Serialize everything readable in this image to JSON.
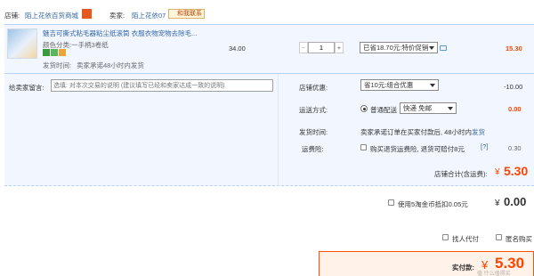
{
  "shop": {
    "label": "店铺:",
    "name": "陌上花依百货商城",
    "seller_label": "卖家:",
    "seller_name": "陌上花依07",
    "contact": "和我联系"
  },
  "item": {
    "title": "魅吉可撕式粘毛器粘尘纸滚筒 衣服衣物宠物去除毛...",
    "variant": "颜色分类:一手柄3卷纸",
    "shipping_time_label": "发货时间:",
    "shipping_time": "卖家承诺48小时内发货",
    "price": "34.00",
    "quantity": "1",
    "discount_option": "已省18.70元:特价促销",
    "subtotal": "15.30"
  },
  "message": {
    "label": "给卖家留言:",
    "placeholder": "选填: 对本次交易的说明 (建议填写已经和卖家达成一致的说明)"
  },
  "coupon": {
    "label": "店铺优惠:",
    "option": "省10元:组合优惠",
    "amount": "-10.00"
  },
  "delivery": {
    "label": "运送方式:",
    "type": "普通配送",
    "option": "快递 免邮",
    "amount": "0.00"
  },
  "ship_time": {
    "label": "发货时间:",
    "text": "卖家承诺订单在买家付款后, 48小时内",
    "link": "发货"
  },
  "insurance": {
    "label": "运费险:",
    "text": "购买退货运费险, 退货可赔付8元",
    "help": "[?]",
    "amount": "0.30"
  },
  "shop_total": {
    "label": "店铺合计(含运费):",
    "currency": "¥",
    "amount": "5.30"
  },
  "points": {
    "text": "使用5淘金币抵扣0.05元",
    "currency": "¥",
    "amount": "0.00"
  },
  "options": {
    "proxy_pay": "找人代付",
    "anonymous": "匿名购买"
  },
  "final": {
    "label": "实付款:",
    "currency": "¥",
    "amount": "5.30"
  },
  "watermark": "值 什么值得买",
  "colors": {
    "accent": "#ff4400",
    "link": "#3366aa",
    "light_blue_bg": "#f2f7ff",
    "border_blue": "#b2d1ff",
    "final_border": "#ff5000",
    "final_bg": "#fff2e8"
  }
}
